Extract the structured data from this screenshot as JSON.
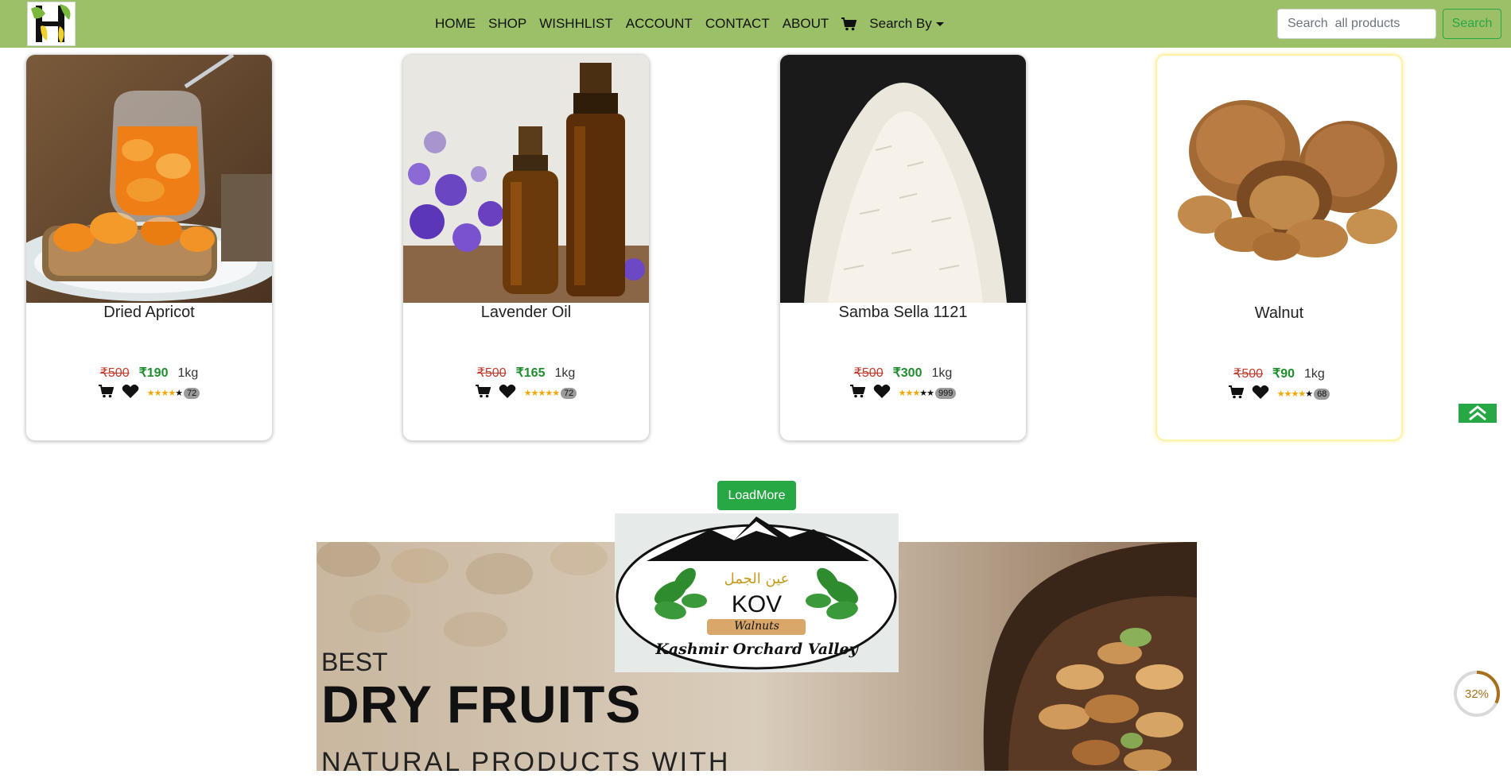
{
  "nav": {
    "links": [
      "HOME",
      "SHOP",
      "WISHHLIST",
      "ACCOUNT",
      "CONTACT",
      "ABOUT"
    ],
    "cart_icon": "cart-icon",
    "dropdown_label": "Search By",
    "search_placeholder": "Search  all products",
    "search_button": "Search"
  },
  "products": [
    {
      "name": "Dried Apricot",
      "old_price": "₹500",
      "price": "₹190",
      "unit": "1kg",
      "rating": 4,
      "reviews": "72"
    },
    {
      "name": "Lavender Oil",
      "old_price": "₹500",
      "price": "₹165",
      "unit": "1kg",
      "rating": 5,
      "reviews": "72"
    },
    {
      "name": "Samba Sella 1121",
      "old_price": "₹500",
      "price": "₹300",
      "unit": "1kg",
      "rating": 3,
      "reviews": "999"
    },
    {
      "name": "Walnut",
      "old_price": "₹500",
      "price": "₹90",
      "unit": "1kg",
      "rating": 4,
      "reviews": "68"
    }
  ],
  "load_more": "LoadMore",
  "banner": {
    "line1": "BEST",
    "line2": "DRY FRUITS",
    "line3": "NATURAL PRODUCTS WITH"
  },
  "kov_logo": {
    "arabic": "عين الجمل",
    "brand": "KOV",
    "product": "Walnuts",
    "tagline": "Kashmir Orchard Valley"
  },
  "scroll_progress": {
    "percent": 32,
    "label": "32%"
  },
  "colors": {
    "navbar": "#9cc068",
    "accent_green": "#28a745",
    "old_price": "#c0392b",
    "new_price": "#1e8e2f"
  }
}
